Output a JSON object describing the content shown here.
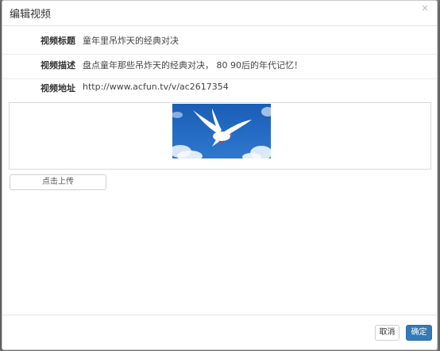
{
  "dialog": {
    "title": "编辑视频",
    "close_glyph": "×"
  },
  "form": {
    "title_label": "视频标题",
    "title_value": "童年里吊炸天的经典对决",
    "desc_label": "视频描述",
    "desc_value": "盘点童年那些吊炸天的经典对决， 80 90后的年代记忆！",
    "url_label": "视频地址",
    "url_value": "http://www.acfun.tv/v/ac2617354"
  },
  "cover": {
    "icon": "white-dove-sky-image"
  },
  "upload": {
    "label": "点击上传"
  },
  "footer": {
    "cancel_label": "取消",
    "ok_label": "确定"
  },
  "colors": {
    "primary": "#337ab7",
    "sky": "#1f62b8"
  }
}
